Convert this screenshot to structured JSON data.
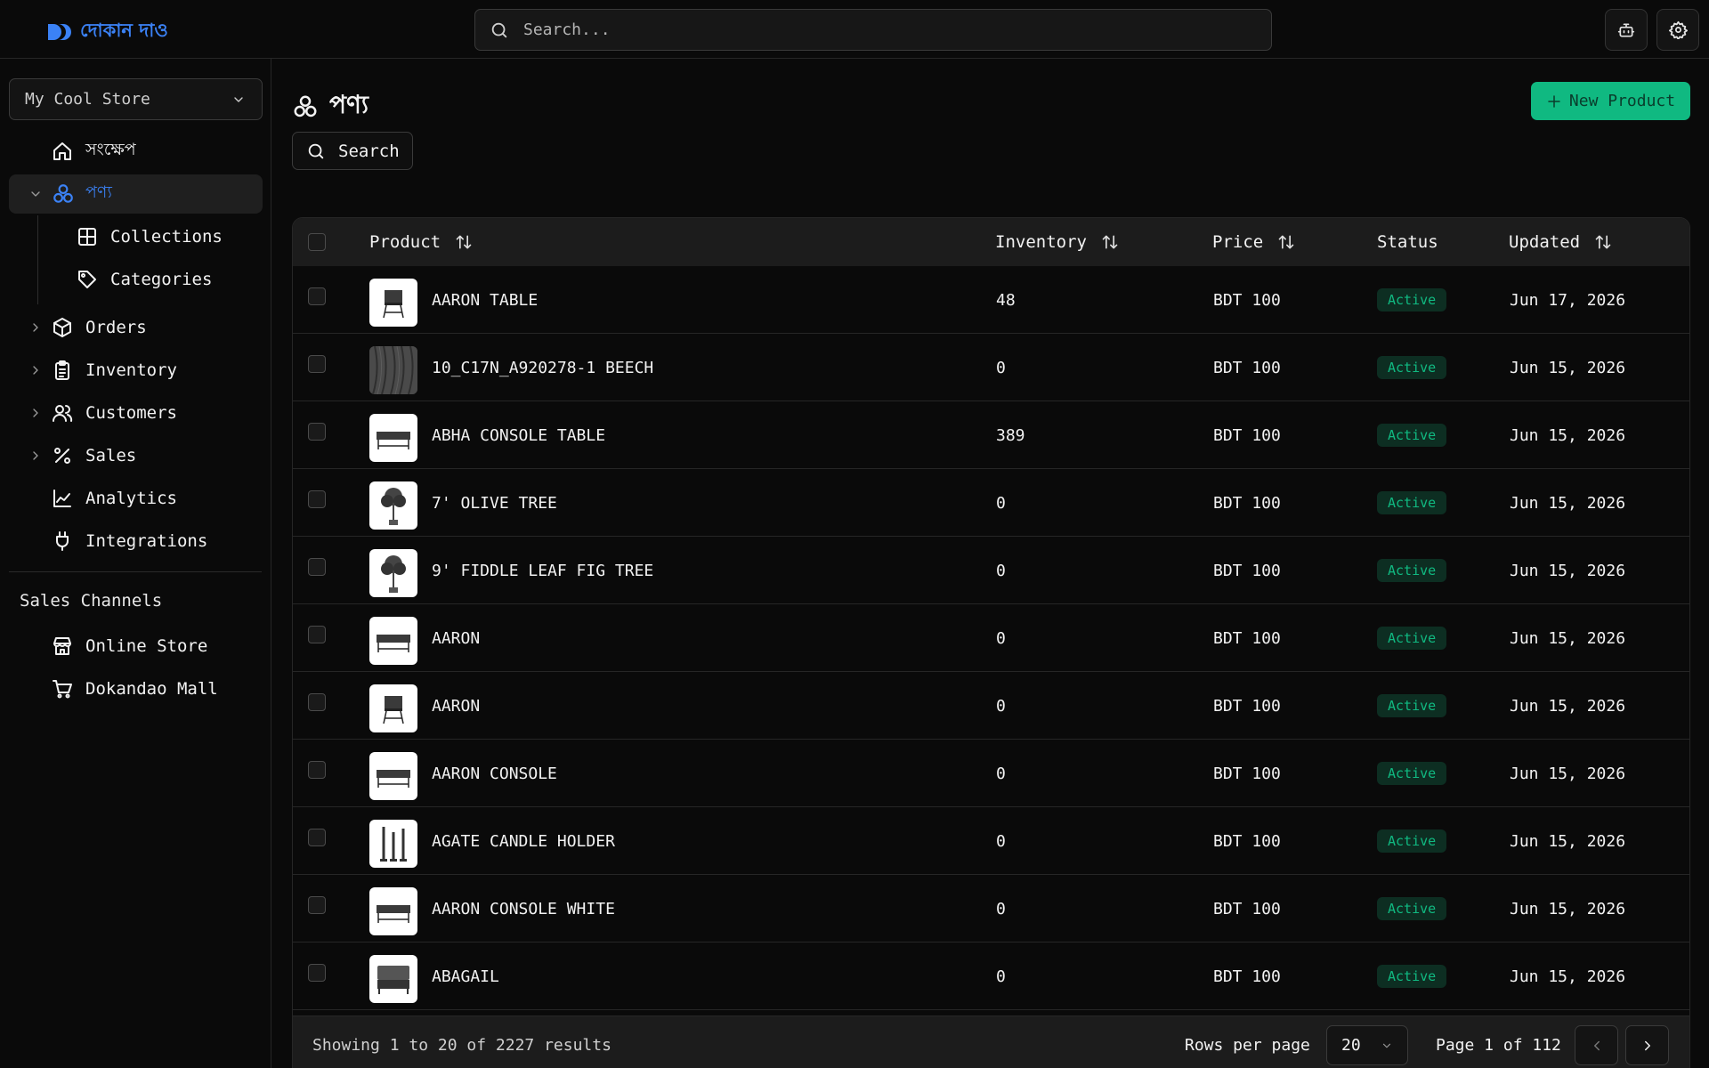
{
  "app": {
    "logo_text": "দোকান দাও",
    "search_placeholder": "Search...",
    "brand_color": "#3b82f6",
    "accent_color": "#10b981"
  },
  "sidebar": {
    "store": "My Cool Store",
    "items": [
      {
        "label": "সংক্ষেপ",
        "icon": "home-icon"
      },
      {
        "label": "পণ্য",
        "icon": "products-icon",
        "expanded": true
      },
      {
        "label": "Collections",
        "icon": "grid-icon"
      },
      {
        "label": "Categories",
        "icon": "tag-icon"
      },
      {
        "label": "Orders",
        "icon": "package-icon"
      },
      {
        "label": "Inventory",
        "icon": "clipboard-icon"
      },
      {
        "label": "Customers",
        "icon": "users-icon"
      },
      {
        "label": "Sales",
        "icon": "percent-icon"
      },
      {
        "label": "Analytics",
        "icon": "chart-line-icon"
      },
      {
        "label": "Integrations",
        "icon": "plug-icon"
      }
    ],
    "channels_title": "Sales Channels",
    "channels": [
      {
        "label": "Online Store",
        "icon": "store-icon"
      },
      {
        "label": "Dokandao Mall",
        "icon": "cart-icon"
      }
    ]
  },
  "main": {
    "title": "পণ্য",
    "new_button": "New Product",
    "search_button": "Search",
    "columns": {
      "product": "Product",
      "inventory": "Inventory",
      "price": "Price",
      "status": "Status",
      "updated": "Updated"
    },
    "rows": [
      {
        "name": "AARON TABLE",
        "inventory": "48",
        "price": "BDT 100",
        "status": "Active",
        "updated": "Jun 17, 2026",
        "thumb": "side-table"
      },
      {
        "name": "10_C17N_A920278-1 BEECH",
        "inventory": "0",
        "price": "BDT 100",
        "status": "Active",
        "updated": "Jun 15, 2026",
        "thumb": "wood-texture"
      },
      {
        "name": "ABHA CONSOLE TABLE",
        "inventory": "389",
        "price": "BDT 100",
        "status": "Active",
        "updated": "Jun 15, 2026",
        "thumb": "console"
      },
      {
        "name": "7' OLIVE TREE",
        "inventory": "0",
        "price": "BDT 100",
        "status": "Active",
        "updated": "Jun 15, 2026",
        "thumb": "tree"
      },
      {
        "name": "9' FIDDLE LEAF FIG TREE",
        "inventory": "0",
        "price": "BDT 100",
        "status": "Active",
        "updated": "Jun 15, 2026",
        "thumb": "tree"
      },
      {
        "name": "AARON",
        "inventory": "0",
        "price": "BDT 100",
        "status": "Active",
        "updated": "Jun 15, 2026",
        "thumb": "console"
      },
      {
        "name": "AARON",
        "inventory": "0",
        "price": "BDT 100",
        "status": "Active",
        "updated": "Jun 15, 2026",
        "thumb": "side-table"
      },
      {
        "name": "AARON CONSOLE",
        "inventory": "0",
        "price": "BDT 100",
        "status": "Active",
        "updated": "Jun 15, 2026",
        "thumb": "console"
      },
      {
        "name": "AGATE CANDLE HOLDER",
        "inventory": "0",
        "price": "BDT 100",
        "status": "Active",
        "updated": "Jun 15, 2026",
        "thumb": "candles"
      },
      {
        "name": "AARON CONSOLE WHITE",
        "inventory": "0",
        "price": "BDT 100",
        "status": "Active",
        "updated": "Jun 15, 2026",
        "thumb": "console"
      },
      {
        "name": "ABAGAIL",
        "inventory": "0",
        "price": "BDT 100",
        "status": "Active",
        "updated": "Jun 15, 2026",
        "thumb": "bed"
      }
    ],
    "footer": {
      "showing": "Showing 1 to 20 of 2227 results",
      "rows_per_page_label": "Rows per page",
      "rows_per_page": "20",
      "page_info": "Page 1 of 112"
    }
  }
}
